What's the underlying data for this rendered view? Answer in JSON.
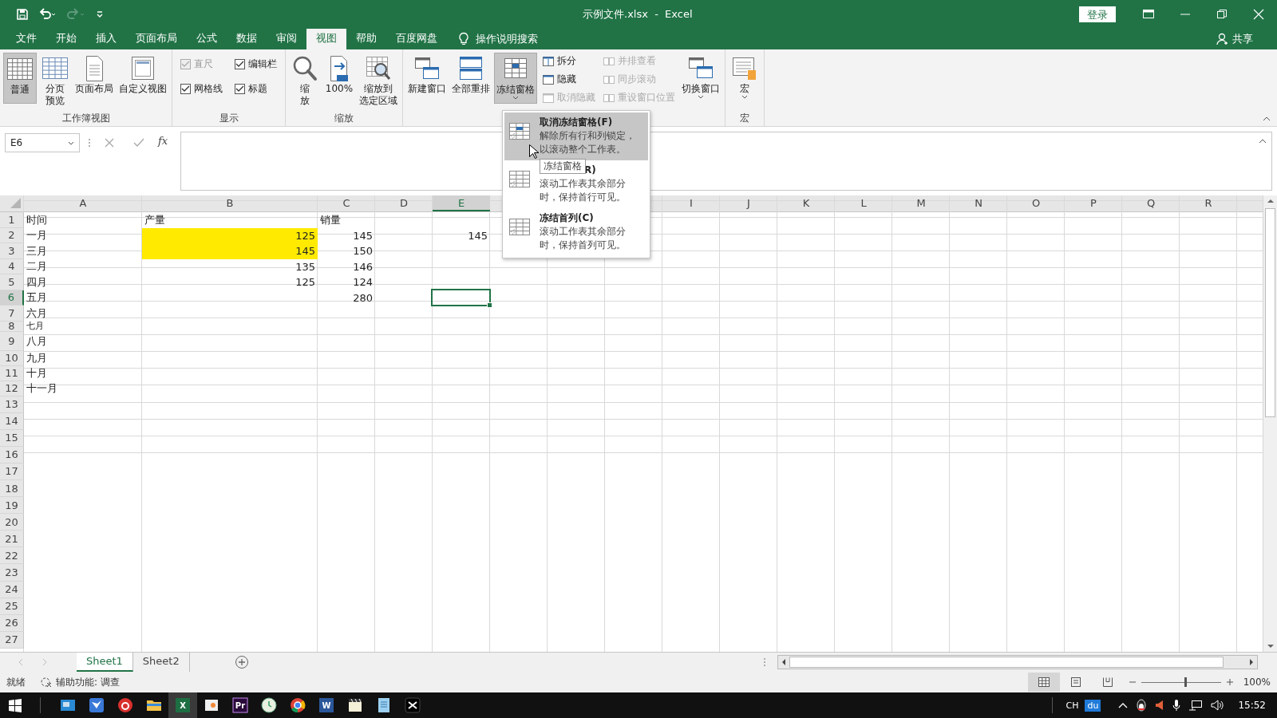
{
  "window": {
    "title": "示例文件.xlsx  -  Excel",
    "sign_in": "登录"
  },
  "menu_tabs": [
    {
      "label": "文件",
      "selected": false
    },
    {
      "label": "开始",
      "selected": false
    },
    {
      "label": "插入",
      "selected": false
    },
    {
      "label": "页面布局",
      "selected": false
    },
    {
      "label": "公式",
      "selected": false
    },
    {
      "label": "数据",
      "selected": false
    },
    {
      "label": "审阅",
      "selected": false
    },
    {
      "label": "视图",
      "selected": true
    },
    {
      "label": "帮助",
      "selected": false
    },
    {
      "label": "百度网盘",
      "selected": false
    }
  ],
  "tell_me": "操作说明搜索",
  "share": "共享",
  "ribbon": {
    "groups": [
      {
        "label": "工作簿视图",
        "columns": [
          [
            {
              "kind": "large",
              "lines": [
                "普通"
              ],
              "selected": true,
              "menu": false
            }
          ],
          [
            {
              "kind": "large",
              "lines": [
                "分页",
                "预览"
              ],
              "selected": false,
              "menu": false
            }
          ],
          [
            {
              "kind": "large",
              "lines": [
                "页面布局"
              ],
              "selected": false,
              "menu": false
            }
          ],
          [
            {
              "kind": "large",
              "lines": [
                "自定义视图"
              ],
              "selected": false,
              "menu": false
            }
          ]
        ]
      },
      {
        "label": "显示",
        "columns": [
          [
            {
              "kind": "check",
              "label": "直尺",
              "checked": true,
              "disabled": true
            },
            {
              "kind": "check",
              "label": "网格线",
              "checked": true,
              "disabled": false
            }
          ],
          [
            {
              "kind": "check",
              "label": "编辑栏",
              "checked": true,
              "disabled": false
            },
            {
              "kind": "check",
              "label": "标题",
              "checked": true,
              "disabled": false
            }
          ]
        ]
      },
      {
        "label": "缩放",
        "columns": [
          [
            {
              "kind": "large",
              "lines": [
                "缩",
                "放"
              ],
              "selected": false,
              "menu": false
            }
          ],
          [
            {
              "kind": "large",
              "lines": [
                "100%"
              ],
              "selected": false,
              "menu": false
            }
          ],
          [
            {
              "kind": "large",
              "lines": [
                "缩放到",
                "选定区域"
              ],
              "selected": false,
              "menu": false
            }
          ]
        ]
      },
      {
        "columns": [
          [
            {
              "kind": "large",
              "lines": [
                "新建窗口"
              ],
              "selected": false,
              "menu": false
            }
          ],
          [
            {
              "kind": "large",
              "lines": [
                "全部重排"
              ],
              "selected": false,
              "menu": false
            }
          ],
          [
            {
              "kind": "large",
              "lines": [
                "冻结窗格"
              ],
              "selected": true,
              "menu": true
            }
          ],
          [
            {
              "kind": "small",
              "label": "拆分",
              "disabled": false
            },
            {
              "kind": "small",
              "label": "隐藏",
              "disabled": false
            },
            {
              "kind": "small",
              "label": "取消隐藏",
              "disabled": true
            }
          ],
          [
            {
              "kind": "small",
              "label": "并排查看",
              "disabled": true
            },
            {
              "kind": "small",
              "label": "同步滚动",
              "disabled": true
            },
            {
              "kind": "small",
              "label": "重设窗口位置",
              "disabled": true
            }
          ],
          [
            {
              "kind": "large",
              "lines": [
                "切换窗口"
              ],
              "selected": false,
              "menu": true
            }
          ]
        ]
      },
      {
        "label": "宏",
        "columns": [
          [
            {
              "kind": "large",
              "lines": [
                "宏"
              ],
              "selected": false,
              "menu": true
            }
          ]
        ]
      }
    ]
  },
  "formula_bar": {
    "name_box": "E6",
    "function_label": "fx"
  },
  "sheet": {
    "columns": [
      {
        "kind": "letter",
        "label": "A",
        "selected": false
      },
      {
        "kind": "letter",
        "label": "B",
        "selected": false
      },
      {
        "kind": "letter",
        "label": "C",
        "selected": false
      },
      {
        "kind": "letter",
        "label": "D",
        "selected": false
      },
      {
        "kind": "letter",
        "label": "E",
        "selected": true
      },
      {
        "kind": "covered"
      },
      {
        "kind": "covered"
      },
      {
        "kind": "covered"
      },
      {
        "kind": "letter",
        "label": "I",
        "selected": false
      },
      {
        "kind": "letter",
        "label": "J",
        "selected": false
      },
      {
        "kind": "letter",
        "label": "K",
        "selected": false
      },
      {
        "kind": "letter",
        "label": "L",
        "selected": false
      },
      {
        "kind": "letter",
        "label": "M",
        "selected": false
      },
      {
        "kind": "letter",
        "label": "N",
        "selected": false
      },
      {
        "kind": "letter",
        "label": "O",
        "selected": false
      },
      {
        "kind": "letter",
        "label": "P",
        "selected": false
      },
      {
        "kind": "letter",
        "label": "Q",
        "selected": false
      },
      {
        "kind": "letter",
        "label": "R",
        "selected": false
      }
    ],
    "rows": [
      {
        "header": "1",
        "selected": false,
        "cells": [
          {
            "kind": "text",
            "text": "时间",
            "highlighted": false
          },
          {
            "kind": "text",
            "text": "产量",
            "highlighted": false
          },
          {
            "kind": "text",
            "text": "销量",
            "highlighted": false
          }
        ]
      },
      {
        "header": "2",
        "selected": false,
        "cells": [
          {
            "kind": "text",
            "text": "一月",
            "highlighted": false
          },
          {
            "kind": "number",
            "text": "125",
            "highlighted": true
          },
          {
            "kind": "number",
            "text": "145",
            "highlighted": false
          },
          {},
          {
            "kind": "number",
            "text": "145",
            "highlighted": false
          }
        ]
      },
      {
        "header": "3",
        "selected": false,
        "cells": [
          {
            "kind": "text",
            "text": "三月",
            "highlighted": false
          },
          {
            "kind": "number",
            "text": "145",
            "highlighted": true
          },
          {
            "kind": "number",
            "text": "150",
            "highlighted": false
          }
        ]
      },
      {
        "header": "4",
        "selected": false,
        "cells": [
          {
            "kind": "text",
            "text": "二月",
            "highlighted": false
          },
          {
            "kind": "number",
            "text": "135",
            "highlighted": false
          },
          {
            "kind": "number",
            "text": "146",
            "highlighted": false
          }
        ]
      },
      {
        "header": "5",
        "selected": false,
        "cells": [
          {
            "kind": "text",
            "text": "四月",
            "highlighted": false
          },
          {
            "kind": "number",
            "text": "125",
            "highlighted": false
          },
          {
            "kind": "number",
            "text": "124",
            "highlighted": false
          }
        ]
      },
      {
        "header": "6",
        "selected": true,
        "cells": [
          {
            "kind": "text",
            "text": "五月",
            "highlighted": false
          },
          {},
          {
            "kind": "number",
            "text": "280",
            "highlighted": false
          }
        ]
      },
      {
        "header": "7",
        "selected": false,
        "cells": [
          {
            "kind": "text",
            "text": "六月",
            "highlighted": false
          }
        ]
      },
      {
        "header": "8",
        "selected": false,
        "cells": [
          {
            "kind": "text",
            "text": "七月",
            "highlighted": false
          }
        ]
      },
      {
        "header": "9",
        "selected": false,
        "cells": [
          {
            "kind": "text",
            "text": "八月",
            "highlighted": false
          }
        ]
      },
      {
        "header": "10",
        "selected": false,
        "cells": [
          {
            "kind": "text",
            "text": "九月",
            "highlighted": false
          }
        ]
      },
      {
        "header": "11",
        "selected": false,
        "cells": [
          {
            "kind": "text",
            "text": "十月",
            "highlighted": false
          }
        ]
      },
      {
        "header": "12",
        "selected": false,
        "cells": [
          {
            "kind": "text",
            "text": "十一月",
            "highlighted": false
          }
        ]
      },
      {
        "header": "13",
        "selected": false,
        "cells": []
      },
      {
        "header": "14",
        "selected": false,
        "cells": []
      },
      {
        "header": "15",
        "selected": false,
        "cells": []
      },
      {
        "header": "16",
        "selected": false,
        "cells": []
      },
      {
        "header": "17",
        "selected": false,
        "cells": []
      },
      {
        "header": "18",
        "selected": false,
        "cells": []
      },
      {
        "header": "19",
        "selected": false,
        "cells": []
      },
      {
        "header": "20",
        "selected": false,
        "cells": []
      },
      {
        "header": "21",
        "selected": false,
        "cells": []
      },
      {
        "header": "22",
        "selected": false,
        "cells": []
      },
      {
        "header": "23",
        "selected": false,
        "cells": []
      },
      {
        "header": "24",
        "selected": false,
        "cells": []
      },
      {
        "header": "25",
        "selected": false,
        "cells": []
      },
      {
        "header": "26",
        "selected": false,
        "cells": []
      },
      {
        "header": "27",
        "selected": false,
        "cells": []
      }
    ]
  },
  "freeze_menu": {
    "items": [
      {
        "title": "取消冻结窗格(F)",
        "lines": [
          "解除所有行和列锁定，",
          "以滚动整个工作表。"
        ],
        "selected": true
      },
      {
        "title": "R)",
        "lines": [
          "滚动工作表其余部分",
          "时，保持首行可见。"
        ],
        "selected": false
      },
      {
        "title": "冻结首列(C)",
        "lines": [
          "滚动工作表其余部分",
          "时，保持首列可见。"
        ],
        "selected": false
      }
    ],
    "tooltip": "冻结窗格"
  },
  "sheet_tabs": [
    {
      "label": "Sheet1",
      "selected": true
    },
    {
      "label": "Sheet2",
      "selected": false
    }
  ],
  "status_bar": {
    "ready": "就绪",
    "accessibility": "辅助功能: 调查",
    "zoom": "100%",
    "zoom_slider": {
      "level": 0.55
    }
  },
  "taskbar": {
    "apps": [
      {
        "kind": "mail",
        "selected": false
      },
      {
        "kind": "bird",
        "selected": false
      },
      {
        "kind": "music",
        "selected": false
      },
      {
        "kind": "folder",
        "selected": false
      },
      {
        "kind": "excel",
        "label": "X",
        "selected": true
      },
      {
        "kind": "photo",
        "selected": false
      },
      {
        "kind": "premiere",
        "label": "Pr",
        "selected": false
      },
      {
        "kind": "clock",
        "selected": false
      },
      {
        "kind": "chrome",
        "selected": false
      },
      {
        "kind": "word",
        "label": "W",
        "selected": false
      },
      {
        "kind": "clapper",
        "selected": false
      },
      {
        "kind": "notepad",
        "selected": false
      },
      {
        "kind": "capcut",
        "selected": false
      }
    ],
    "ime": "CH",
    "badge": "du",
    "time": "15:52"
  }
}
